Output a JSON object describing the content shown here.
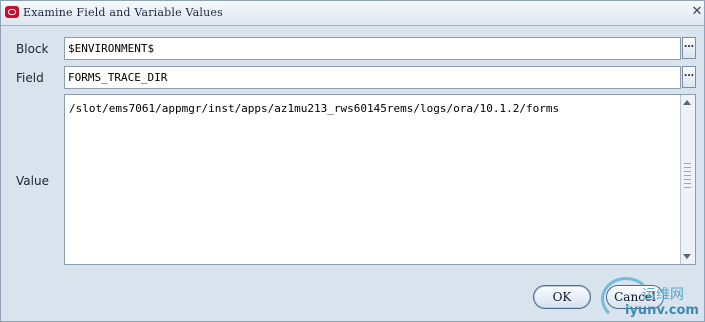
{
  "window": {
    "title": "Examine Field and Variable Values",
    "close_glyph": "✕"
  },
  "form": {
    "block_label": "Block",
    "block_value": "$ENVIRONMENT$",
    "field_label": "Field",
    "field_value": "FORMS_TRACE_DIR",
    "value_label": "Value",
    "value_text": "/slot/ems7061/appmgr/inst/apps/az1mu213_rws60145rems/logs/ora/10.1.2/forms",
    "lov_glyph": "…"
  },
  "buttons": {
    "ok": "OK",
    "cancel": "Cancel"
  },
  "watermark": {
    "line1": "运维网",
    "line2": "iyunv.com"
  },
  "colors": {
    "dialog_bg": "#d9e3ee",
    "app_icon": "#c8102e",
    "button_border": "#4d6a8c"
  }
}
